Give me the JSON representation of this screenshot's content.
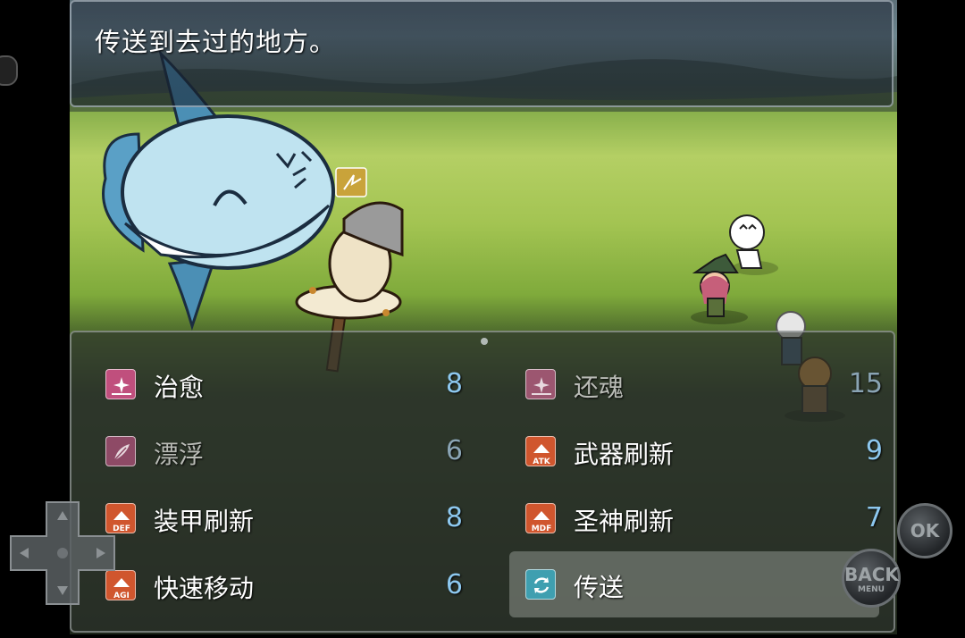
{
  "message": {
    "text": "传送到去过的地方。"
  },
  "skills": [
    {
      "icon": "heal-icon",
      "name": "治愈",
      "cost": "8",
      "enabled": true,
      "selected": false,
      "color": "#c04f7d"
    },
    {
      "icon": "revive-icon",
      "name": "还魂",
      "cost": "15",
      "enabled": false,
      "selected": false,
      "color": "#b05a7a"
    },
    {
      "icon": "feather-icon",
      "name": "漂浮",
      "cost": "6",
      "enabled": false,
      "selected": false,
      "color": "#a04f6f"
    },
    {
      "icon": "atk-up-icon",
      "name": "武器刷新",
      "cost": "9",
      "enabled": true,
      "selected": false,
      "color": "#d0562e",
      "badge": "ATK"
    },
    {
      "icon": "def-up-icon",
      "name": "装甲刷新",
      "cost": "8",
      "enabled": true,
      "selected": false,
      "color": "#d0562e",
      "badge": "DEF"
    },
    {
      "icon": "mdf-up-icon",
      "name": "圣神刷新",
      "cost": "7",
      "enabled": true,
      "selected": false,
      "color": "#d0562e",
      "badge": "MDF"
    },
    {
      "icon": "agi-up-icon",
      "name": "快速移动",
      "cost": "6",
      "enabled": true,
      "selected": false,
      "color": "#d0562e",
      "badge": "AGI"
    },
    {
      "icon": "teleport-icon",
      "name": "传送",
      "cost": "",
      "enabled": true,
      "selected": true,
      "color": "#3f9fb0"
    }
  ],
  "controls": {
    "ok": "OK",
    "back": "BACK",
    "back_sub": "MENU"
  }
}
